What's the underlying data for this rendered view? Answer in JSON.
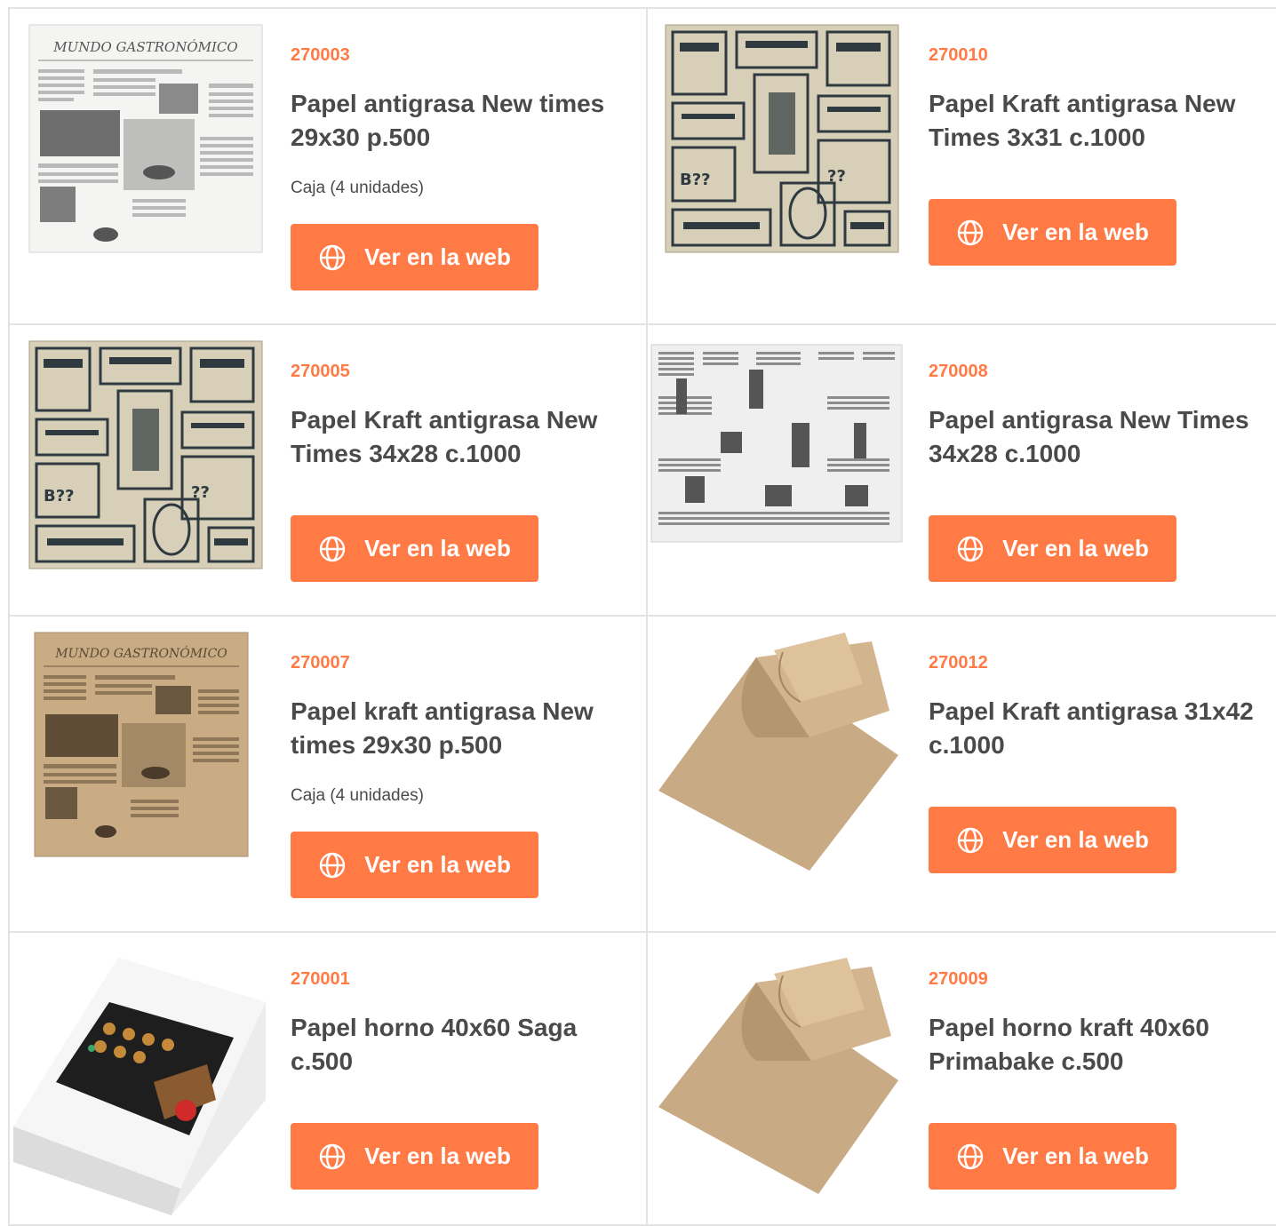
{
  "products": [
    {
      "sku": "270003",
      "title": "Papel antigrasa New times 29x30 p.500",
      "unit": "Caja (4 unidades)",
      "button": "Ver en la web",
      "image": "newspaper-white-paper"
    },
    {
      "sku": "270010",
      "title": "Papel Kraft antigrasa New Times 3x31 c.1000",
      "unit": "",
      "button": "Ver en la web",
      "image": "vintage-ads-kraft-paper"
    },
    {
      "sku": "270005",
      "title": "Papel Kraft antigrasa New Times 34x28 c.1000",
      "unit": "",
      "button": "Ver en la web",
      "image": "vintage-ads-kraft-paper"
    },
    {
      "sku": "270008",
      "title": "Papel antigrasa New Times 34x28 c.1000",
      "unit": "",
      "button": "Ver en la web",
      "image": "vintage-newspaper-white-paper"
    },
    {
      "sku": "270007",
      "title": "Papel kraft antigrasa New times 29x30 p.500",
      "unit": "Caja (4 unidades)",
      "button": "Ver en la web",
      "image": "newspaper-kraft-paper"
    },
    {
      "sku": "270012",
      "title": "Papel Kraft antigrasa 31x42 c.1000",
      "unit": "",
      "button": "Ver en la web",
      "image": "kraft-sheets"
    },
    {
      "sku": "270001",
      "title": "Papel horno 40x60 Saga c.500",
      "unit": "",
      "button": "Ver en la web",
      "image": "baking-paper-box"
    },
    {
      "sku": "270009",
      "title": "Papel horno kraft 40x60 Primabake c.500",
      "unit": "",
      "button": "Ver en la web",
      "image": "kraft-sheets"
    }
  ],
  "image_texts": {
    "masthead": "MUNDO GASTRONÓMICO"
  },
  "colors": {
    "accent": "#ff7a45",
    "title": "#4a4a4a",
    "border": "#e3e3e3"
  }
}
